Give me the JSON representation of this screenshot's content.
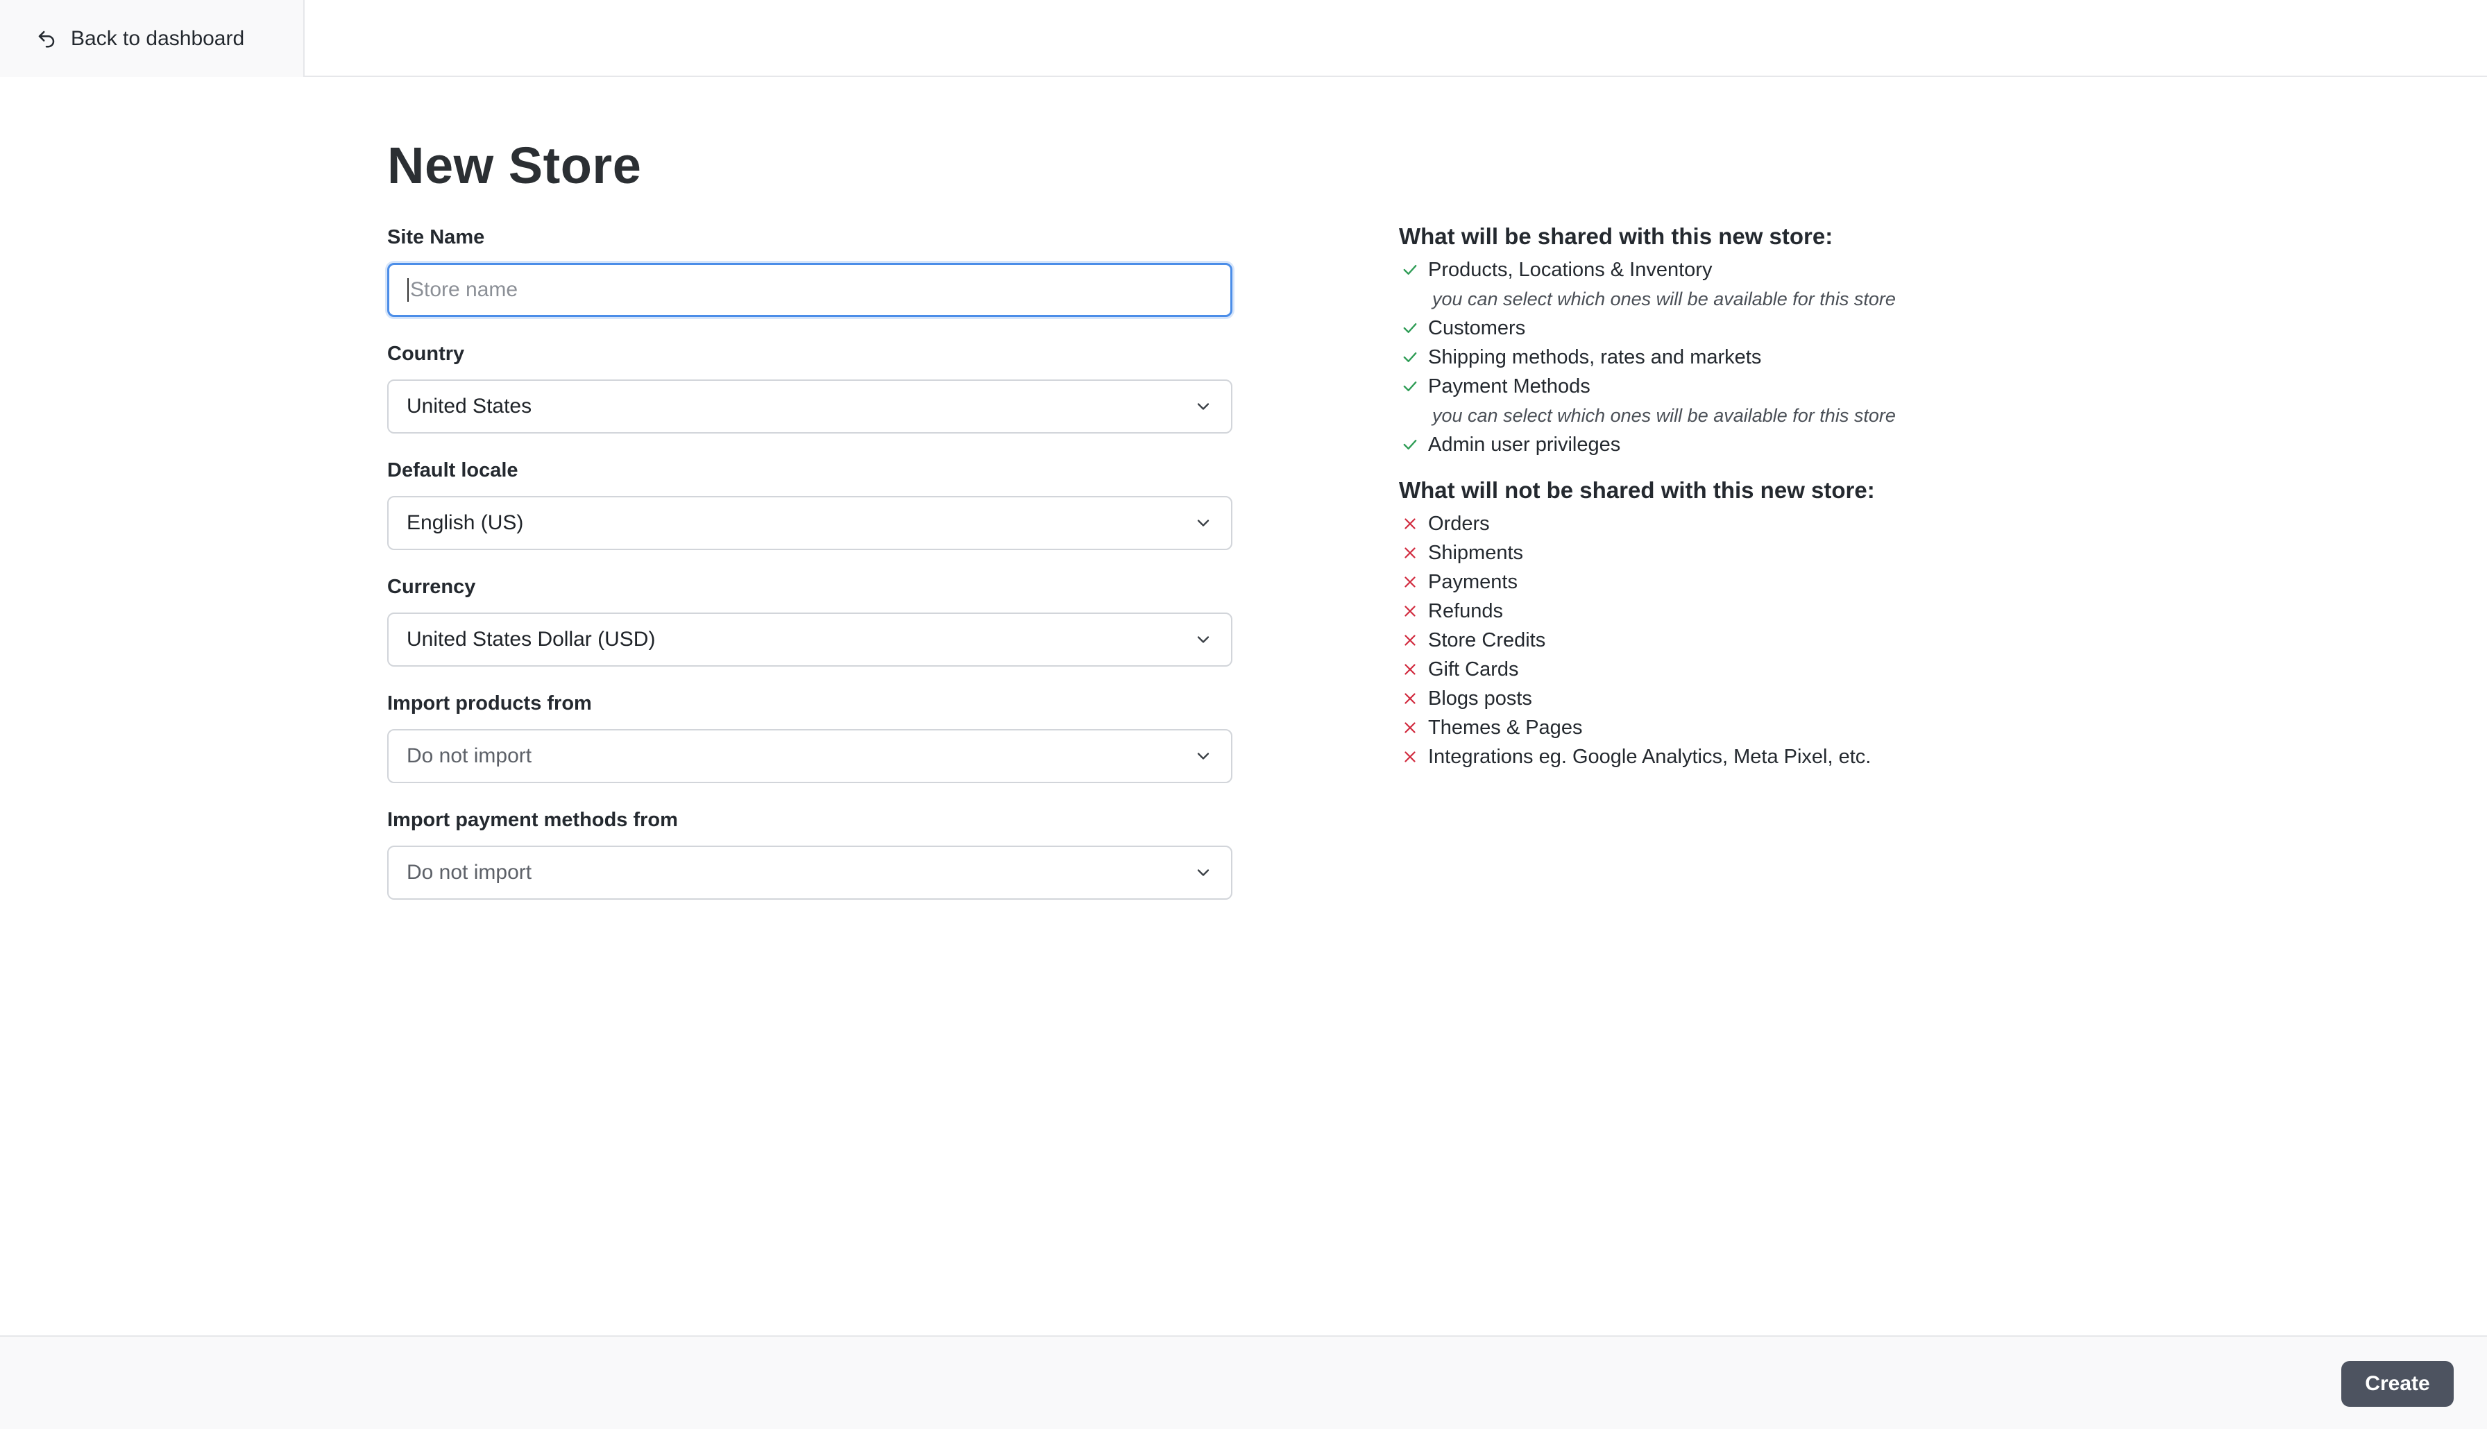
{
  "header": {
    "back_label": "Back to dashboard",
    "back_icon": "return-arrow-icon"
  },
  "page": {
    "title": "New Store"
  },
  "form": {
    "site_name": {
      "label": "Site Name",
      "placeholder": "Store name",
      "value": ""
    },
    "country": {
      "label": "Country",
      "value": "United States"
    },
    "locale": {
      "label": "Default locale",
      "value": "English (US)"
    },
    "currency": {
      "label": "Currency",
      "value": "United States Dollar (USD)"
    },
    "import_products": {
      "label": "Import products from",
      "value": "Do not import"
    },
    "import_payments": {
      "label": "Import payment methods from",
      "value": "Do not import"
    }
  },
  "shared": {
    "title": "What will be shared with this new store:",
    "items": [
      {
        "label": "Products, Locations & Inventory",
        "note": "you can select which ones will be available for this store"
      },
      {
        "label": "Customers"
      },
      {
        "label": "Shipping methods, rates and markets"
      },
      {
        "label": "Payment Methods",
        "note": "you can select which ones will be available for this store"
      },
      {
        "label": "Admin user privileges"
      }
    ]
  },
  "not_shared": {
    "title": "What will not be shared with this new store:",
    "items": [
      "Orders",
      "Shipments",
      "Payments",
      "Refunds",
      "Store Credits",
      "Gift Cards",
      "Blogs posts",
      "Themes & Pages",
      "Integrations eg. Google Analytics, Meta Pixel, etc."
    ]
  },
  "footer": {
    "create_label": "Create"
  },
  "colors": {
    "check": "#2e9c55",
    "cross": "#d1293d",
    "focus": "#4b8de8",
    "button": "#4d5360"
  }
}
